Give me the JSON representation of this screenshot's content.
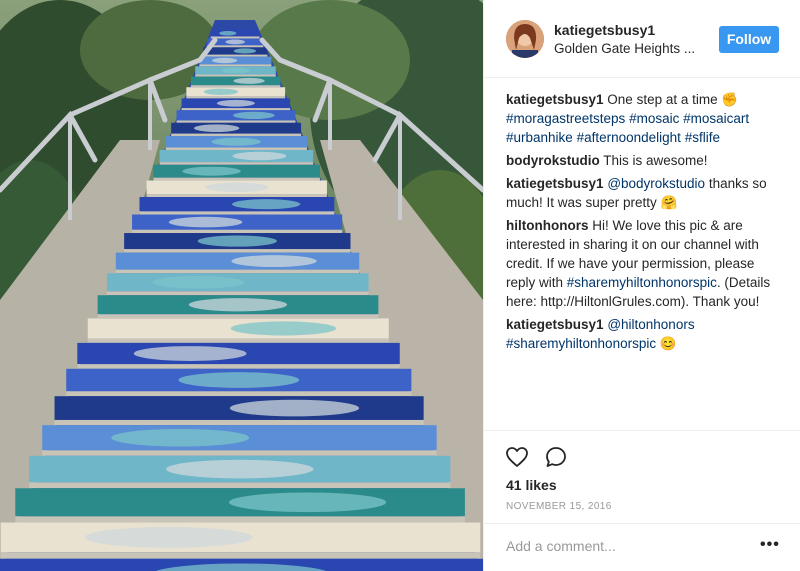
{
  "post": {
    "username": "katiegetsbusy1",
    "location": "Golden Gate Heights ...",
    "follow_label": "Follow",
    "likes": "41 likes",
    "date": "NOVEMBER 15, 2016",
    "add_comment_placeholder": "Add a comment...",
    "more_label": "•••"
  },
  "comments": [
    {
      "user": "katiegetsbusy1",
      "parts": [
        {
          "text": " One step at a time ✊",
          "tag": false
        },
        {
          "text": "\n",
          "tag": false
        },
        {
          "text": "#moragastreetsteps",
          "tag": true
        },
        {
          "text": " ",
          "tag": false
        },
        {
          "text": "#mosaic",
          "tag": true
        },
        {
          "text": " ",
          "tag": false
        },
        {
          "text": "#mosaicart",
          "tag": true
        },
        {
          "text": " ",
          "tag": false
        },
        {
          "text": "#urbanhike",
          "tag": true
        },
        {
          "text": " ",
          "tag": false
        },
        {
          "text": "#afternoondelight",
          "tag": true
        },
        {
          "text": " ",
          "tag": false
        },
        {
          "text": "#sflife",
          "tag": true
        }
      ]
    },
    {
      "user": "bodyrokstudio",
      "parts": [
        {
          "text": " This is awesome!",
          "tag": false
        }
      ]
    },
    {
      "user": "katiegetsbusy1",
      "parts": [
        {
          "text": " ",
          "tag": false
        },
        {
          "text": "@bodyrokstudio",
          "tag": true
        },
        {
          "text": " thanks so much! It was super pretty 🤗",
          "tag": false
        }
      ]
    },
    {
      "user": "hiltonhonors",
      "parts": [
        {
          "text": " Hi! We love this pic & are interested in sharing it on our channel with credit. If we have your permission, please reply with ",
          "tag": false
        },
        {
          "text": "#sharemyhiltonhonorspic",
          "tag": true
        },
        {
          "text": ". (Details here: http://HiltonlGrules.com). Thank you!",
          "tag": false
        }
      ]
    },
    {
      "user": "katiegetsbusy1",
      "parts": [
        {
          "text": " ",
          "tag": false
        },
        {
          "text": "@hiltonhonors",
          "tag": true
        },
        {
          "text": " ",
          "tag": false
        },
        {
          "text": "#sharemyhiltonhonorspic",
          "tag": true
        },
        {
          "text": " 😊",
          "tag": false
        }
      ]
    }
  ],
  "icons": {
    "like": "heart-icon",
    "comment": "comment-icon",
    "more": "more-options-icon"
  },
  "colors": {
    "follow_button": "#3897f0",
    "link": "#003569",
    "muted": "#999999"
  }
}
